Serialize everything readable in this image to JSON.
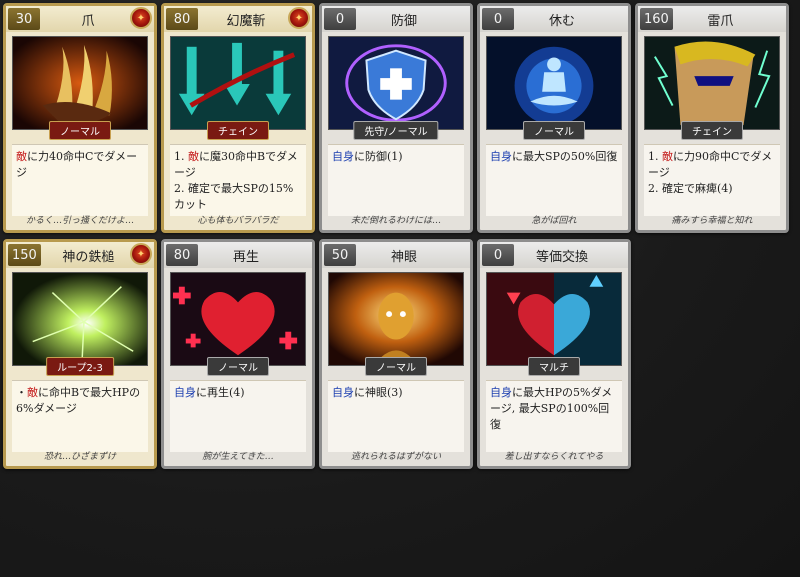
{
  "cards": [
    {
      "cost": "30",
      "name": "爪",
      "tag": "ノーマル",
      "desc": [
        {
          "seg": [
            {
              "t": "敵",
              "c": "red"
            },
            {
              "t": "に力40命中Cでダメージ",
              "c": ""
            }
          ]
        }
      ],
      "flavor": "かるく…引っ掻くだけよ…",
      "frame": "gold",
      "badge": true,
      "tagStyle": "red",
      "art": "claw"
    },
    {
      "cost": "80",
      "name": "幻魔斬",
      "tag": "チェイン",
      "desc": [
        {
          "seg": [
            {
              "t": "1. ",
              "c": ""
            },
            {
              "t": "敵",
              "c": "red"
            },
            {
              "t": "に魔30命中Bでダメージ",
              "c": ""
            }
          ]
        },
        {
          "seg": [
            {
              "t": "2. 確定で最大SPの15%カット",
              "c": ""
            }
          ]
        }
      ],
      "flavor": "心も体もバラバラだ",
      "frame": "gold",
      "badge": true,
      "tagStyle": "red",
      "art": "slash"
    },
    {
      "cost": "0",
      "name": "防御",
      "tag": "先守/ノーマル",
      "desc": [
        {
          "seg": [
            {
              "t": "自身",
              "c": "blue"
            },
            {
              "t": "に防御(1)",
              "c": ""
            }
          ]
        }
      ],
      "flavor": "未だ倒れるわけには…",
      "frame": "silver",
      "badge": false,
      "tagStyle": "dark",
      "art": "shield"
    },
    {
      "cost": "0",
      "name": "休む",
      "tag": "ノーマル",
      "desc": [
        {
          "seg": [
            {
              "t": "自身",
              "c": "blue"
            },
            {
              "t": "に最大SPの50%回復",
              "c": ""
            }
          ]
        }
      ],
      "flavor": "急がば回れ",
      "frame": "silver",
      "badge": false,
      "tagStyle": "dark",
      "art": "rest"
    },
    {
      "cost": "160",
      "name": "雷爪",
      "tag": "チェイン",
      "desc": [
        {
          "seg": [
            {
              "t": "1. ",
              "c": ""
            },
            {
              "t": "敵",
              "c": "red"
            },
            {
              "t": "に力90命中Cでダメージ",
              "c": ""
            }
          ]
        },
        {
          "seg": [
            {
              "t": "2. 確定で麻痺(4)",
              "c": ""
            }
          ]
        }
      ],
      "flavor": "痛みすら幸福と知れ",
      "frame": "silver",
      "badge": false,
      "tagStyle": "dark",
      "art": "thunder"
    },
    {
      "cost": "150",
      "name": "神の鉄槌",
      "tag": "ループ2-3",
      "desc": [
        {
          "seg": [
            {
              "t": "・",
              "c": ""
            },
            {
              "t": "敵",
              "c": "red"
            },
            {
              "t": "に命中Bで最大HPの6%ダメージ",
              "c": ""
            }
          ]
        }
      ],
      "flavor": "恐れ…ひざまずけ",
      "frame": "gold",
      "badge": true,
      "tagStyle": "red",
      "art": "hammer"
    },
    {
      "cost": "80",
      "name": "再生",
      "tag": "ノーマル",
      "desc": [
        {
          "seg": [
            {
              "t": "自身",
              "c": "blue"
            },
            {
              "t": "に再生(4)",
              "c": ""
            }
          ]
        }
      ],
      "flavor": "腕が生えてきた…",
      "frame": "silver",
      "badge": false,
      "tagStyle": "dark",
      "art": "heart"
    },
    {
      "cost": "50",
      "name": "神眼",
      "tag": "ノーマル",
      "desc": [
        {
          "seg": [
            {
              "t": "自身",
              "c": "blue"
            },
            {
              "t": "に神眼(3)",
              "c": ""
            }
          ]
        }
      ],
      "flavor": "逃れられるはずがない",
      "frame": "silver",
      "badge": false,
      "tagStyle": "dark",
      "art": "eye"
    },
    {
      "cost": "0",
      "name": "等価交換",
      "tag": "マルチ",
      "desc": [
        {
          "seg": [
            {
              "t": "自身",
              "c": "blue"
            },
            {
              "t": "に最大HPの5%ダメージ, 最大SPの100%回復",
              "c": ""
            }
          ]
        }
      ],
      "flavor": "差し出すならくれてやる",
      "frame": "silver",
      "badge": false,
      "tagStyle": "dark",
      "art": "exchange"
    }
  ]
}
